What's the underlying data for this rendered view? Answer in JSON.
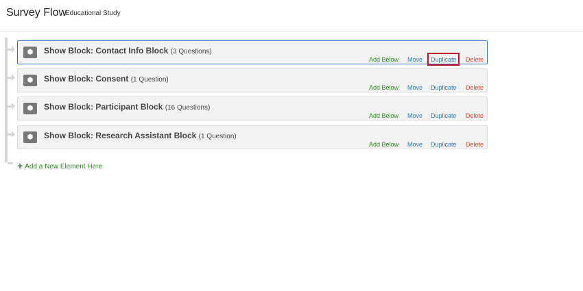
{
  "header": {
    "title": "Survey Flow",
    "subtitle": "Educational Study"
  },
  "blocks": [
    {
      "name": "Show Block: Contact Info Block",
      "count": "(3 Questions)",
      "selected": true
    },
    {
      "name": "Show Block: Consent",
      "count": "(1 Question)"
    },
    {
      "name": "Show Block: Participant Block",
      "count": "(16 Questions)"
    },
    {
      "name": "Show Block: Research Assistant Block",
      "count": "(1 Question)"
    }
  ],
  "actions": {
    "add_below": "Add Below",
    "move": "Move",
    "duplicate": "Duplicate",
    "delete": "Delete"
  },
  "add_element": "Add a New Element Here"
}
